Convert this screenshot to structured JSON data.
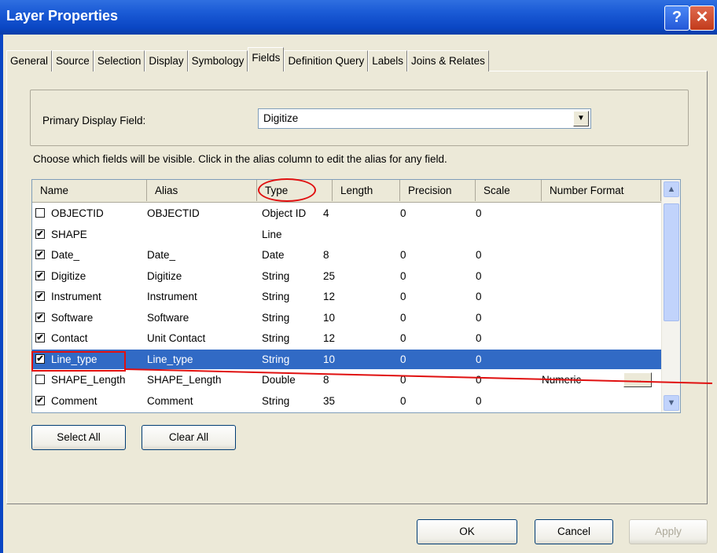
{
  "window": {
    "title": "Layer Properties",
    "help_glyph": "?",
    "close_glyph": "✕"
  },
  "tabs": [
    {
      "label": "General"
    },
    {
      "label": "Source"
    },
    {
      "label": "Selection"
    },
    {
      "label": "Display"
    },
    {
      "label": "Symbology"
    },
    {
      "label": "Fields",
      "active": true
    },
    {
      "label": "Definition Query"
    },
    {
      "label": "Labels"
    },
    {
      "label": "Joins & Relates"
    }
  ],
  "primary_display": {
    "label": "Primary Display Field:",
    "value": "Digitize",
    "dropdown_glyph": "▼"
  },
  "instructions": "Choose which fields will be visible. Click in the alias column to edit the alias for any field.",
  "table": {
    "headers": [
      "Name",
      "Alias",
      "Type",
      "Length",
      "Precision",
      "Scale",
      "Number Format"
    ],
    "rows": [
      {
        "checked": false,
        "name": "OBJECTID",
        "alias": "OBJECTID",
        "type": "Object ID",
        "length": "4",
        "precision": "0",
        "scale": "0",
        "format": ""
      },
      {
        "checked": true,
        "name": "SHAPE",
        "alias": "",
        "type": "Line",
        "length": "",
        "precision": "",
        "scale": "",
        "format": ""
      },
      {
        "checked": true,
        "name": "Date_",
        "alias": "Date_",
        "type": "Date",
        "length": "8",
        "precision": "0",
        "scale": "0",
        "format": ""
      },
      {
        "checked": true,
        "name": "Digitize",
        "alias": "Digitize",
        "type": "String",
        "length": "25",
        "precision": "0",
        "scale": "0",
        "format": ""
      },
      {
        "checked": true,
        "name": "Instrument",
        "alias": "Instrument",
        "type": "String",
        "length": "12",
        "precision": "0",
        "scale": "0",
        "format": ""
      },
      {
        "checked": true,
        "name": "Software",
        "alias": "Software",
        "type": "String",
        "length": "10",
        "precision": "0",
        "scale": "0",
        "format": ""
      },
      {
        "checked": true,
        "name": "Contact",
        "alias": "Unit Contact",
        "type": "String",
        "length": "12",
        "precision": "0",
        "scale": "0",
        "format": ""
      },
      {
        "checked": true,
        "name": "Line_type",
        "alias": "Line_type",
        "type": "String",
        "length": "10",
        "precision": "0",
        "scale": "0",
        "format": "",
        "selected": true
      },
      {
        "checked": false,
        "name": "SHAPE_Length",
        "alias": "SHAPE_Length",
        "type": "Double",
        "length": "8",
        "precision": "0",
        "scale": "0",
        "format": "Numeric",
        "has_format_button": true
      },
      {
        "checked": true,
        "name": "Comment",
        "alias": "Comment",
        "type": "String",
        "length": "35",
        "precision": "0",
        "scale": "0",
        "format": ""
      }
    ],
    "format_button_label": "...",
    "scroll_up_glyph": "▲",
    "scroll_down_glyph": "▼"
  },
  "buttons": {
    "select_all": "Select All",
    "clear_all": "Clear All",
    "ok": "OK",
    "cancel": "Cancel",
    "apply": "Apply"
  },
  "colors": {
    "titlebar": "#0a46c4",
    "selection": "#316ac5",
    "annotation_red": "#e01010"
  }
}
